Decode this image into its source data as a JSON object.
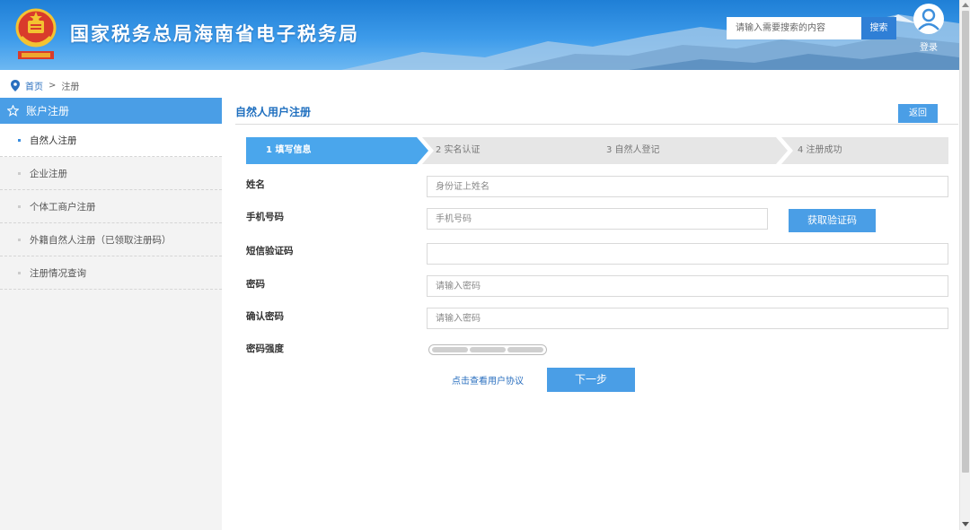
{
  "header": {
    "title": "国家税务总局海南省电子税务局",
    "search_placeholder": "请输入需要搜索的内容",
    "search_button": "搜索",
    "login_label": "登录"
  },
  "breadcrumb": {
    "home": "首页",
    "separator": ">",
    "current": "注册"
  },
  "sidebar": {
    "heading": "账户注册",
    "items": [
      {
        "label": "自然人注册",
        "active": true
      },
      {
        "label": "企业注册"
      },
      {
        "label": "个体工商户注册"
      },
      {
        "label": "外籍自然人注册（已领取注册码）"
      },
      {
        "label": "注册情况查询"
      }
    ]
  },
  "main": {
    "title": "自然人用户注册",
    "back_button": "返回",
    "steps": [
      {
        "label": "1  填写信息",
        "active": true
      },
      {
        "label": "2  实名认证"
      },
      {
        "label": "3  自然人登记"
      },
      {
        "label": "4  注册成功"
      }
    ],
    "form": {
      "name_label": "姓名",
      "name_placeholder": "身份证上姓名",
      "phone_label": "手机号码",
      "phone_placeholder": "手机号码",
      "get_code_button": "获取验证码",
      "sms_label": "短信验证码",
      "sms_value": "",
      "password_label": "密码",
      "password_placeholder": "请输入密码",
      "confirm_label": "确认密码",
      "confirm_placeholder": "请输入密码",
      "strength_label": "密码强度"
    },
    "agreement_link": "点击查看用户协议",
    "next_button": "下一步"
  },
  "colors": {
    "accent": "#4a9ee6",
    "header_blue": "#1f7fd6",
    "link": "#2a6fbf",
    "step_inactive": "#e6e6e6"
  }
}
